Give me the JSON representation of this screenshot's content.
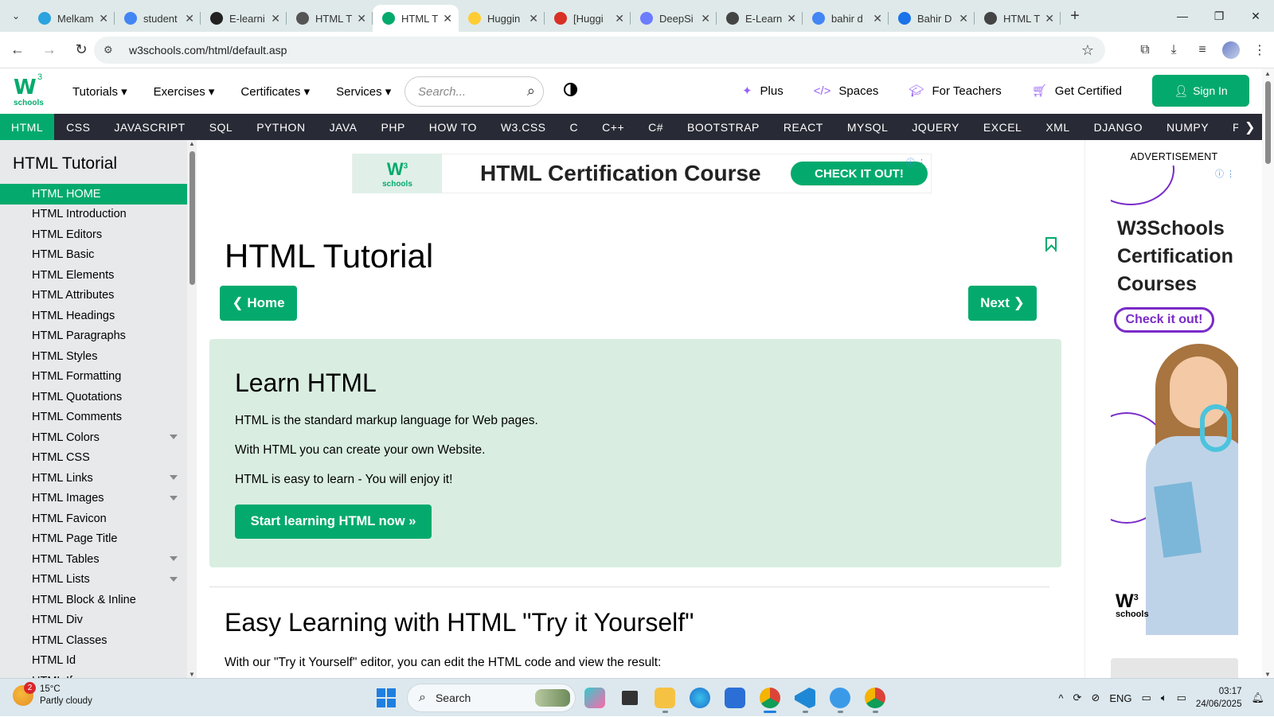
{
  "browser": {
    "tabs": [
      {
        "label": "Melkam",
        "icon": "telegram-icon",
        "color": "#2aa3e0"
      },
      {
        "label": "student",
        "icon": "google-icon",
        "color": "#4285f4"
      },
      {
        "label": "E-learni",
        "icon": "chatgpt-icon",
        "color": "#222222"
      },
      {
        "label": "HTML T",
        "icon": "link-icon",
        "color": "#555555"
      },
      {
        "label": "HTML T",
        "icon": "w3schools-icon",
        "color": "#04aa6d",
        "active": true
      },
      {
        "label": "Huggin",
        "icon": "huggingface-icon",
        "color": "#ffcc33"
      },
      {
        "label": "[Huggi",
        "icon": "gmail-icon",
        "color": "#d93025"
      },
      {
        "label": "DeepSi",
        "icon": "deepsite-icon",
        "color": "#6b7cff"
      },
      {
        "label": "E-Learn",
        "icon": "globe-icon",
        "color": "#444444"
      },
      {
        "label": "bahir d",
        "icon": "google-icon",
        "color": "#4285f4"
      },
      {
        "label": "Bahir D",
        "icon": "play-icon",
        "color": "#1a73e8"
      },
      {
        "label": "HTML T",
        "icon": "globe-icon",
        "color": "#444444"
      }
    ],
    "url": "w3schools.com/html/default.asp"
  },
  "w3": {
    "menu": [
      "Tutorials ▾",
      "Exercises ▾",
      "Certificates ▾",
      "Services ▾"
    ],
    "search_placeholder": "Search...",
    "right_links": [
      {
        "label": "Plus",
        "icon": "sparkle-icon"
      },
      {
        "label": "Spaces",
        "icon": "code-icon"
      },
      {
        "label": "For Teachers",
        "icon": "graduation-cap-icon"
      },
      {
        "label": "Get Certified",
        "icon": "cart-icon"
      }
    ],
    "signin": "Sign In",
    "subjects": [
      "HTML",
      "CSS",
      "JAVASCRIPT",
      "SQL",
      "PYTHON",
      "JAVA",
      "PHP",
      "HOW TO",
      "W3.CSS",
      "C",
      "C++",
      "C#",
      "BOOTSTRAP",
      "REACT",
      "MYSQL",
      "JQUERY",
      "EXCEL",
      "XML",
      "DJANGO",
      "NUMPY",
      "PANI"
    ],
    "active_subject": "HTML",
    "logo_sup": "3",
    "logo_text": "schools"
  },
  "sidebar": {
    "title": "HTML Tutorial",
    "items": [
      {
        "label": "HTML HOME",
        "active": true
      },
      {
        "label": "HTML Introduction"
      },
      {
        "label": "HTML Editors"
      },
      {
        "label": "HTML Basic"
      },
      {
        "label": "HTML Elements"
      },
      {
        "label": "HTML Attributes"
      },
      {
        "label": "HTML Headings"
      },
      {
        "label": "HTML Paragraphs"
      },
      {
        "label": "HTML Styles"
      },
      {
        "label": "HTML Formatting"
      },
      {
        "label": "HTML Quotations"
      },
      {
        "label": "HTML Comments"
      },
      {
        "label": "HTML Colors",
        "caret": true
      },
      {
        "label": "HTML CSS"
      },
      {
        "label": "HTML Links",
        "caret": true
      },
      {
        "label": "HTML Images",
        "caret": true
      },
      {
        "label": "HTML Favicon"
      },
      {
        "label": "HTML Page Title"
      },
      {
        "label": "HTML Tables",
        "caret": true
      },
      {
        "label": "HTML Lists",
        "caret": true
      },
      {
        "label": "HTML Block & Inline"
      },
      {
        "label": "HTML Div"
      },
      {
        "label": "HTML Classes"
      },
      {
        "label": "HTML Id"
      },
      {
        "label": "HTML Iframes"
      }
    ]
  },
  "main": {
    "ad_banner": {
      "title": "HTML Certification Course",
      "cta": "CHECK IT OUT!",
      "logo_sup": "3",
      "logo_text": "schools"
    },
    "page_title": "HTML Tutorial",
    "prev_button": "❮ Home",
    "next_button": "Next ❯",
    "learn_box": {
      "heading": "Learn HTML",
      "lines": [
        "HTML is the standard markup language for Web pages.",
        "With HTML you can create your own Website.",
        "HTML is easy to learn - You will enjoy it!"
      ],
      "button": "Start learning HTML now »"
    },
    "section_title": "Easy Learning with HTML \"Try it Yourself\"",
    "section_sub": "With our \"Try it Yourself\" editor, you can edit the HTML code and view the result:"
  },
  "right_ad": {
    "label": "ADVERTISEMENT",
    "title": "W3Schools Certification Courses",
    "cta": "Check it out!",
    "logo_sup": "3",
    "logo_text": "schools"
  },
  "taskbar": {
    "weather_badge": "2",
    "temp": "15°C",
    "condition": "Partly cloudy",
    "search": "Search",
    "lang": "ENG",
    "time": "03:17",
    "date": "24/06/2025"
  }
}
